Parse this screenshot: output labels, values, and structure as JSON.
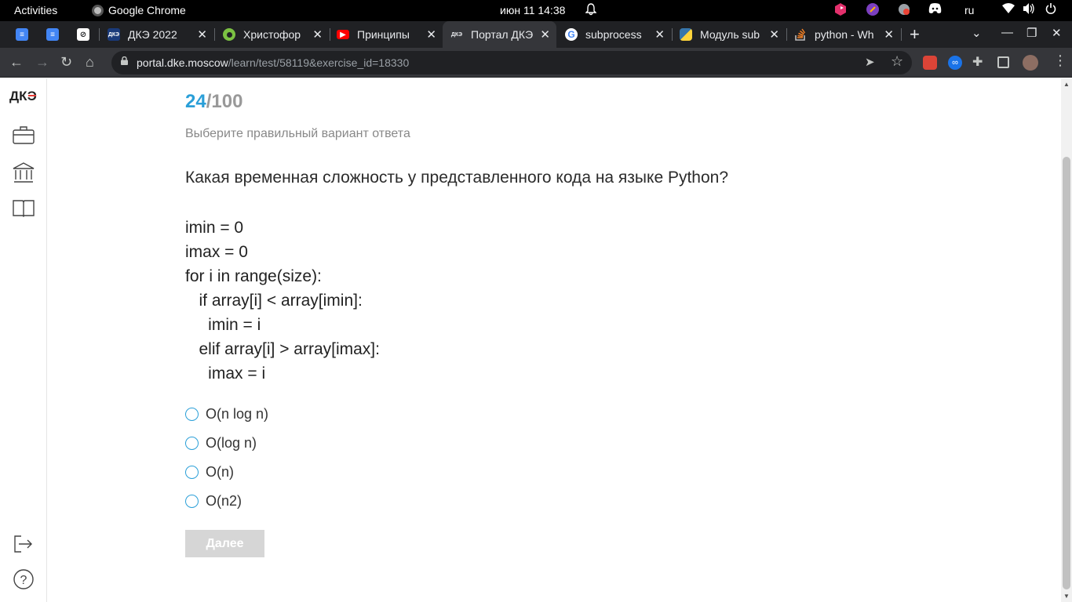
{
  "system_bar": {
    "activities": "Activities",
    "app_name": "Google Chrome",
    "clock": "июн 11  14:38",
    "language": "ru"
  },
  "tabs": [
    {
      "title": "",
      "icon": "docs-icon",
      "color": "#4285f4"
    },
    {
      "title": "",
      "icon": "docs-icon",
      "color": "#4285f4"
    },
    {
      "title": "",
      "icon": "link-icon",
      "color": "#202124"
    },
    {
      "title": "ДКЭ 2022",
      "icon": "dke-icon",
      "color": "#1a3a7a"
    },
    {
      "title": "Христофор",
      "icon": "circle-icon",
      "color": "#7bc142"
    },
    {
      "title": "Принципы",
      "icon": "youtube-icon",
      "color": "#ff0000"
    },
    {
      "title": "Портал ДКЭ",
      "icon": "dke-portal-icon",
      "color": "#35363a"
    },
    {
      "title": "subprocess",
      "icon": "google-icon",
      "color": "#ffffff"
    },
    {
      "title": "Модуль sub",
      "icon": "python-icon",
      "color": "#3776ab"
    },
    {
      "title": "python - Wh",
      "icon": "stackoverflow-icon",
      "color": "#f48024"
    }
  ],
  "address_bar": {
    "host": "portal.dke.moscow",
    "path": "/learn/test/58119&exercise_id=18330"
  },
  "sidebar": {
    "logo": "ДКЭ",
    "items": [
      "briefcase-icon",
      "institution-icon",
      "book-icon"
    ],
    "bottom": [
      "logout-icon",
      "help-icon"
    ]
  },
  "quiz": {
    "current": "24",
    "total": "/100",
    "instruction": "Выберите правильный вариант ответа",
    "question": "Какая временная сложность у представленного кода на языке Python?",
    "code_lines": [
      "imin = 0",
      "imax = 0",
      "for i in range(size):",
      "   if array[i] < array[imin]:",
      "     imin = i",
      "   elif array[i] > array[imax]:",
      "     imax = i"
    ],
    "options": [
      "O(n log n)",
      "O(log n)",
      "O(n)",
      "O(n2)"
    ],
    "next_label": "Далее"
  },
  "colors": {
    "accent": "#2a9fd8",
    "disabled_button": "#d6d6d6"
  }
}
